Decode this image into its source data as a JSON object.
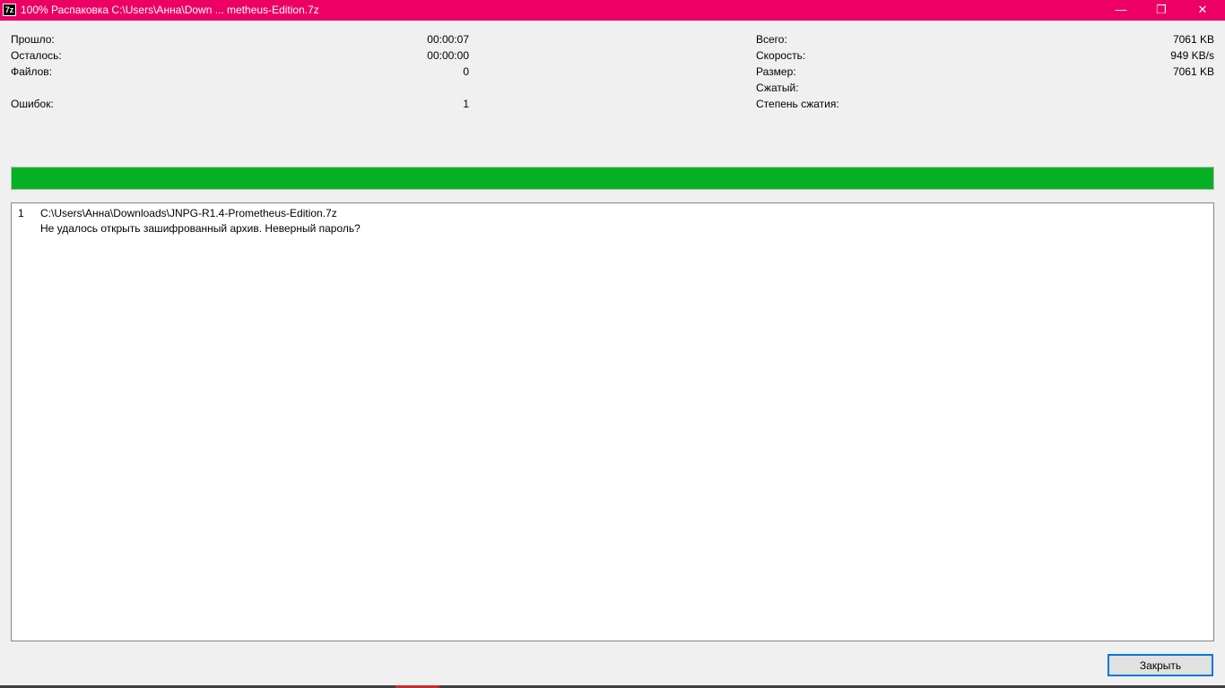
{
  "window": {
    "title": "100% Распаковка C:\\Users\\Анна\\Down ... metheus-Edition.7z",
    "icon_text": "7z",
    "minimize": "—",
    "restore": "❐",
    "close": "✕"
  },
  "stats_left": [
    {
      "label": "Прошло:",
      "value": "00:00:07"
    },
    {
      "label": "Осталось:",
      "value": "00:00:00"
    },
    {
      "label": "Файлов:",
      "value": "0"
    },
    {
      "label": "Ошибок:",
      "value": "1"
    }
  ],
  "stats_right": [
    {
      "label": "Всего:",
      "value": "7061 KB"
    },
    {
      "label": "Скорость:",
      "value": "949 KB/s"
    },
    {
      "label": "Размер:",
      "value": "7061 KB"
    },
    {
      "label": "Сжатый:",
      "value": ""
    },
    {
      "label": "Степень сжатия:",
      "value": ""
    }
  ],
  "progress": {
    "percent": 100,
    "color": "#06b025"
  },
  "log": [
    {
      "num": "1",
      "path": "C:\\Users\\Анна\\Downloads\\JNPG-R1.4-Prometheus-Edition.7z",
      "message": "Не удалось открыть зашифрованный архив. Неверный пароль?"
    }
  ],
  "buttons": {
    "close": "Закрыть"
  }
}
